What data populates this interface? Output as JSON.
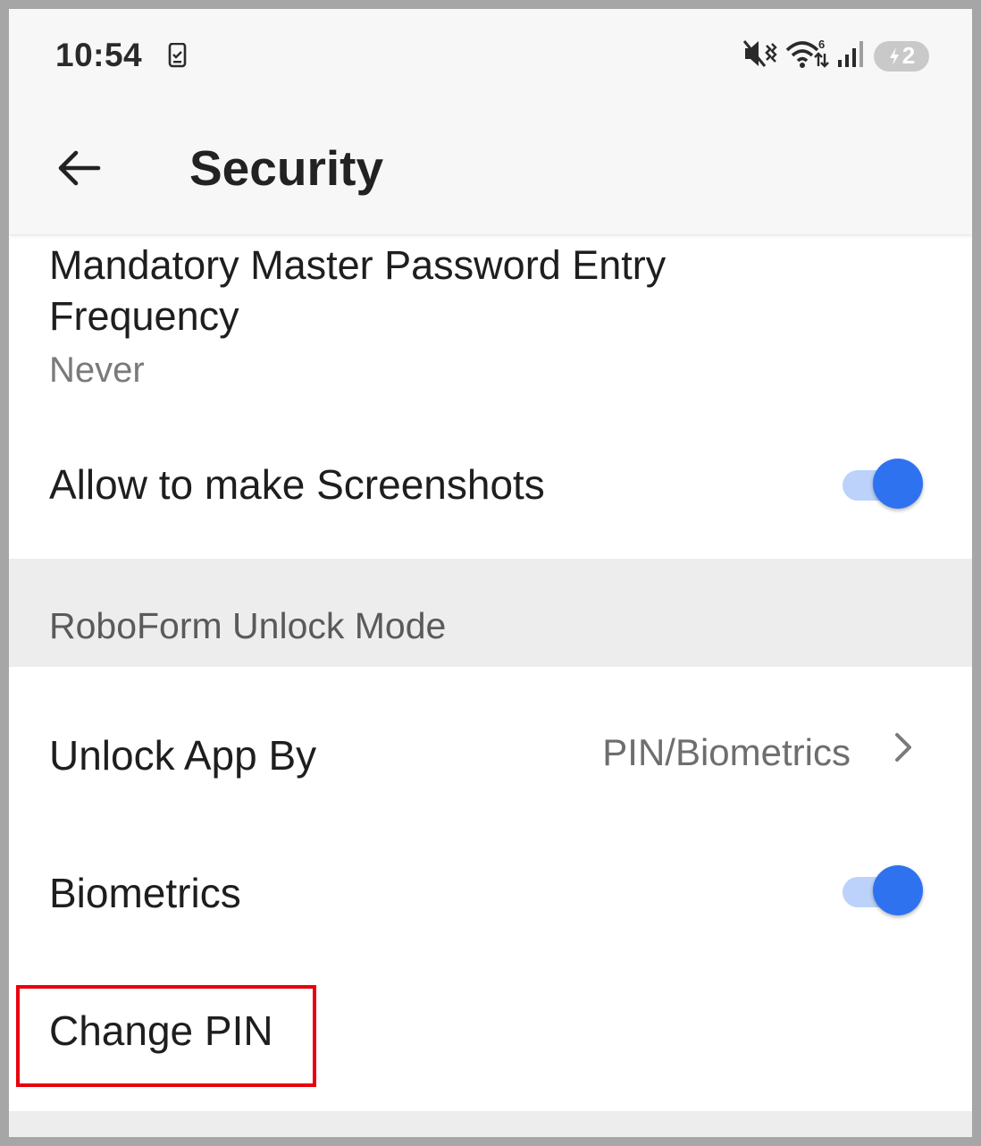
{
  "status_bar": {
    "time": "10:54",
    "left_icon": "phone-clipboard-icon",
    "right_icons": [
      "mute-vibrate-icon",
      "wifi-6-icon",
      "signal-icon",
      "battery-charging-icon"
    ],
    "battery_level": "2"
  },
  "app_bar": {
    "back_icon": "back-arrow-icon",
    "title": "Security"
  },
  "settings": {
    "password_frequency": {
      "label": "Mandatory Master Password Entry Frequency",
      "value": "Never"
    },
    "screenshots": {
      "label": "Allow to make Screenshots",
      "enabled": true
    },
    "section_header": "RoboForm Unlock Mode",
    "unlock_app_by": {
      "label": "Unlock App By",
      "value": "PIN/Biometrics"
    },
    "biometrics": {
      "label": "Biometrics",
      "enabled": true
    },
    "change_pin": {
      "label": "Change PIN"
    }
  },
  "colors": {
    "accent": "#2f72f0",
    "toggle_track": "#bcd2fb",
    "highlight": "#e8000d",
    "section_bg": "#ededed"
  }
}
